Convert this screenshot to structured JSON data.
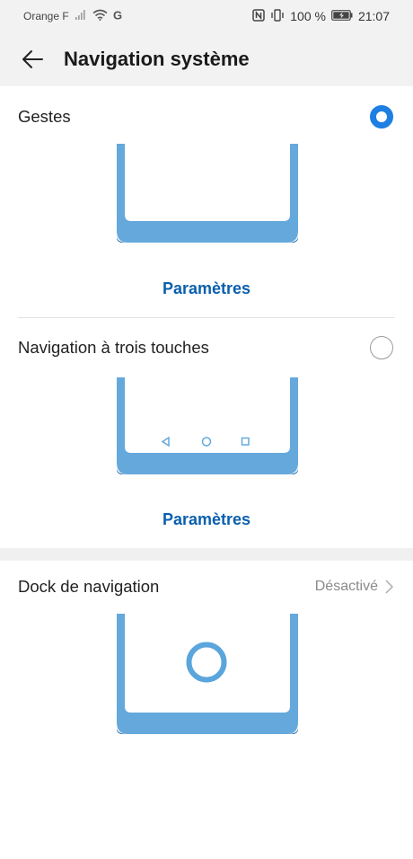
{
  "status_bar": {
    "carrier": "Orange F",
    "battery": "100 %",
    "time": "21:07"
  },
  "header": {
    "title": "Navigation système"
  },
  "options": [
    {
      "label": "Gestes",
      "selected": true,
      "link": "Paramètres"
    },
    {
      "label": "Navigation à trois touches",
      "selected": false,
      "link": "Paramètres"
    }
  ],
  "dock": {
    "label": "Dock de navigation",
    "value": "Désactivé"
  },
  "icons": [
    "back-arrow-icon",
    "signal-icon",
    "wifi-icon",
    "g-icon",
    "nfc-icon",
    "vibrate-icon",
    "battery-icon",
    "chevron-right-icon"
  ],
  "colors": {
    "accent": "#1e7fe3",
    "link": "#0a5fad",
    "illustration": "#65a9dc"
  }
}
